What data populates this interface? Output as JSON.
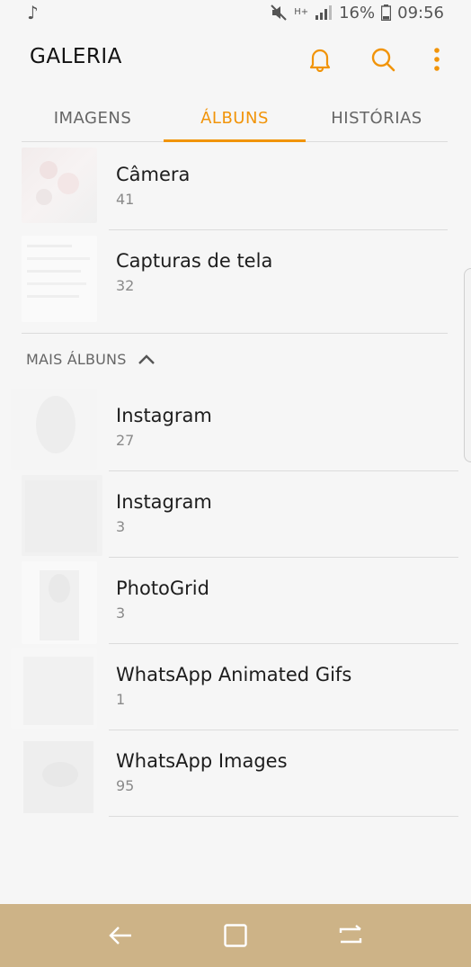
{
  "status_bar": {
    "battery": "16%",
    "time": "09:56",
    "network": "H+"
  },
  "app_bar": {
    "title": "GALERIA"
  },
  "tabs": [
    {
      "label": "IMAGENS"
    },
    {
      "label": "ÁLBUNS"
    },
    {
      "label": "HISTÓRIAS"
    }
  ],
  "albums": [
    {
      "name": "Câmera",
      "count": "41"
    },
    {
      "name": "Capturas de tela",
      "count": "32"
    }
  ],
  "more_albums": {
    "header": "MAIS ÁLBUNS",
    "items": [
      {
        "name": "Instagram",
        "count": "27"
      },
      {
        "name": "Instagram",
        "count": "3"
      },
      {
        "name": "PhotoGrid",
        "count": "3"
      },
      {
        "name": "WhatsApp Animated Gifs",
        "count": "1"
      },
      {
        "name": "WhatsApp Images",
        "count": "95"
      }
    ]
  },
  "colors": {
    "accent": "#f19409",
    "nav_bar": "#cdb387"
  }
}
